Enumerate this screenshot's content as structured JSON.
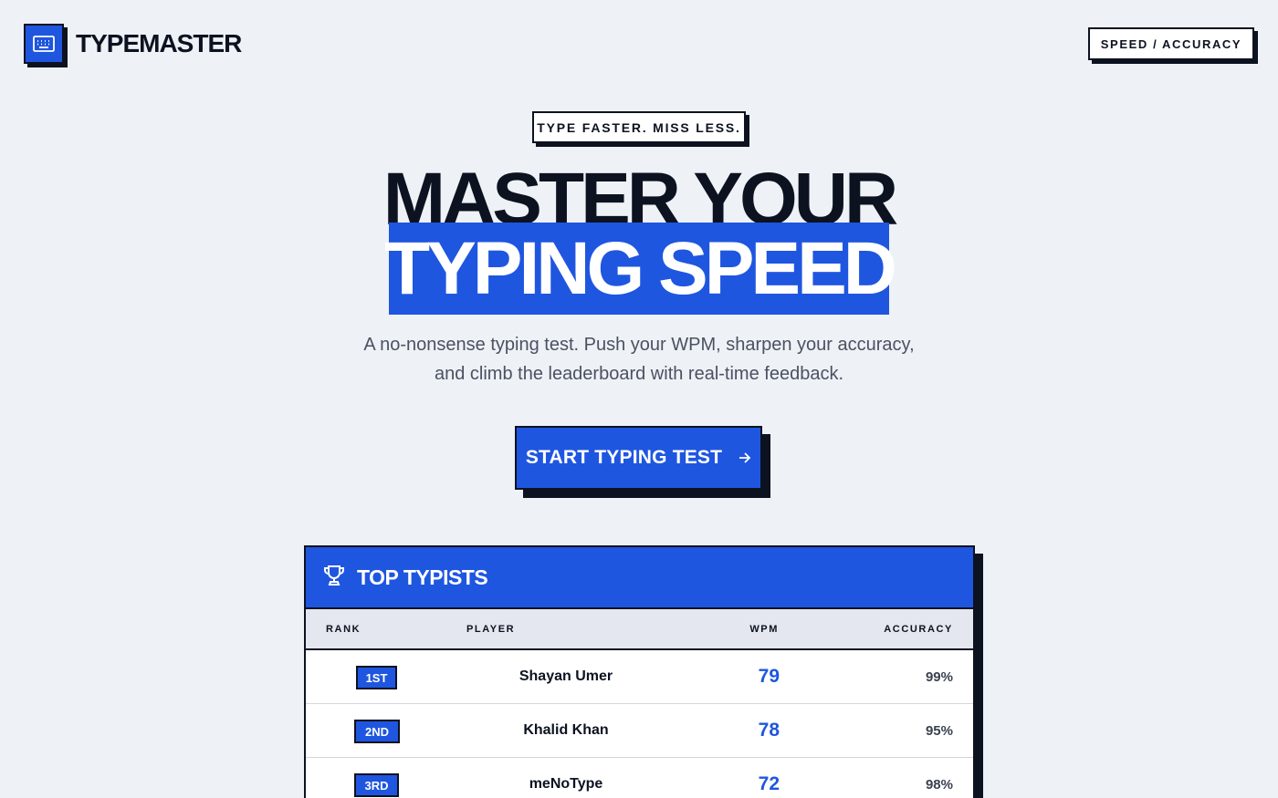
{
  "header": {
    "logo_text": "TYPEMASTER",
    "badge": "SPEED / ACCURACY"
  },
  "hero": {
    "tagline": "TYPE FASTER. MISS LESS.",
    "headline_line1": "MASTER YOUR",
    "headline_line2": "TYPING SPEED",
    "subtitle_line1": "A no-nonsense typing test. Push your WPM, sharpen your accuracy,",
    "subtitle_line2": "and climb the leaderboard with real-time feedback.",
    "cta_label": "START TYPING TEST"
  },
  "leaderboard": {
    "title": "TOP TYPISTS",
    "columns": {
      "rank": "RANK",
      "player": "PLAYER",
      "wpm": "WPM",
      "accuracy": "ACCURACY"
    },
    "rows": [
      {
        "rank": "1ST",
        "player": "Shayan Umer",
        "wpm": "79",
        "accuracy": "99%"
      },
      {
        "rank": "2ND",
        "player": "Khalid Khan",
        "wpm": "78",
        "accuracy": "95%"
      },
      {
        "rank": "3RD",
        "player": "meNoType",
        "wpm": "72",
        "accuracy": "98%"
      }
    ]
  },
  "colors": {
    "accent": "#1f56e0",
    "ink": "#0c1220",
    "background": "#eef1f6"
  },
  "icons": {
    "logo": "keyboard-icon",
    "cta": "arrow-right-icon",
    "leaderboard": "trophy-icon"
  }
}
